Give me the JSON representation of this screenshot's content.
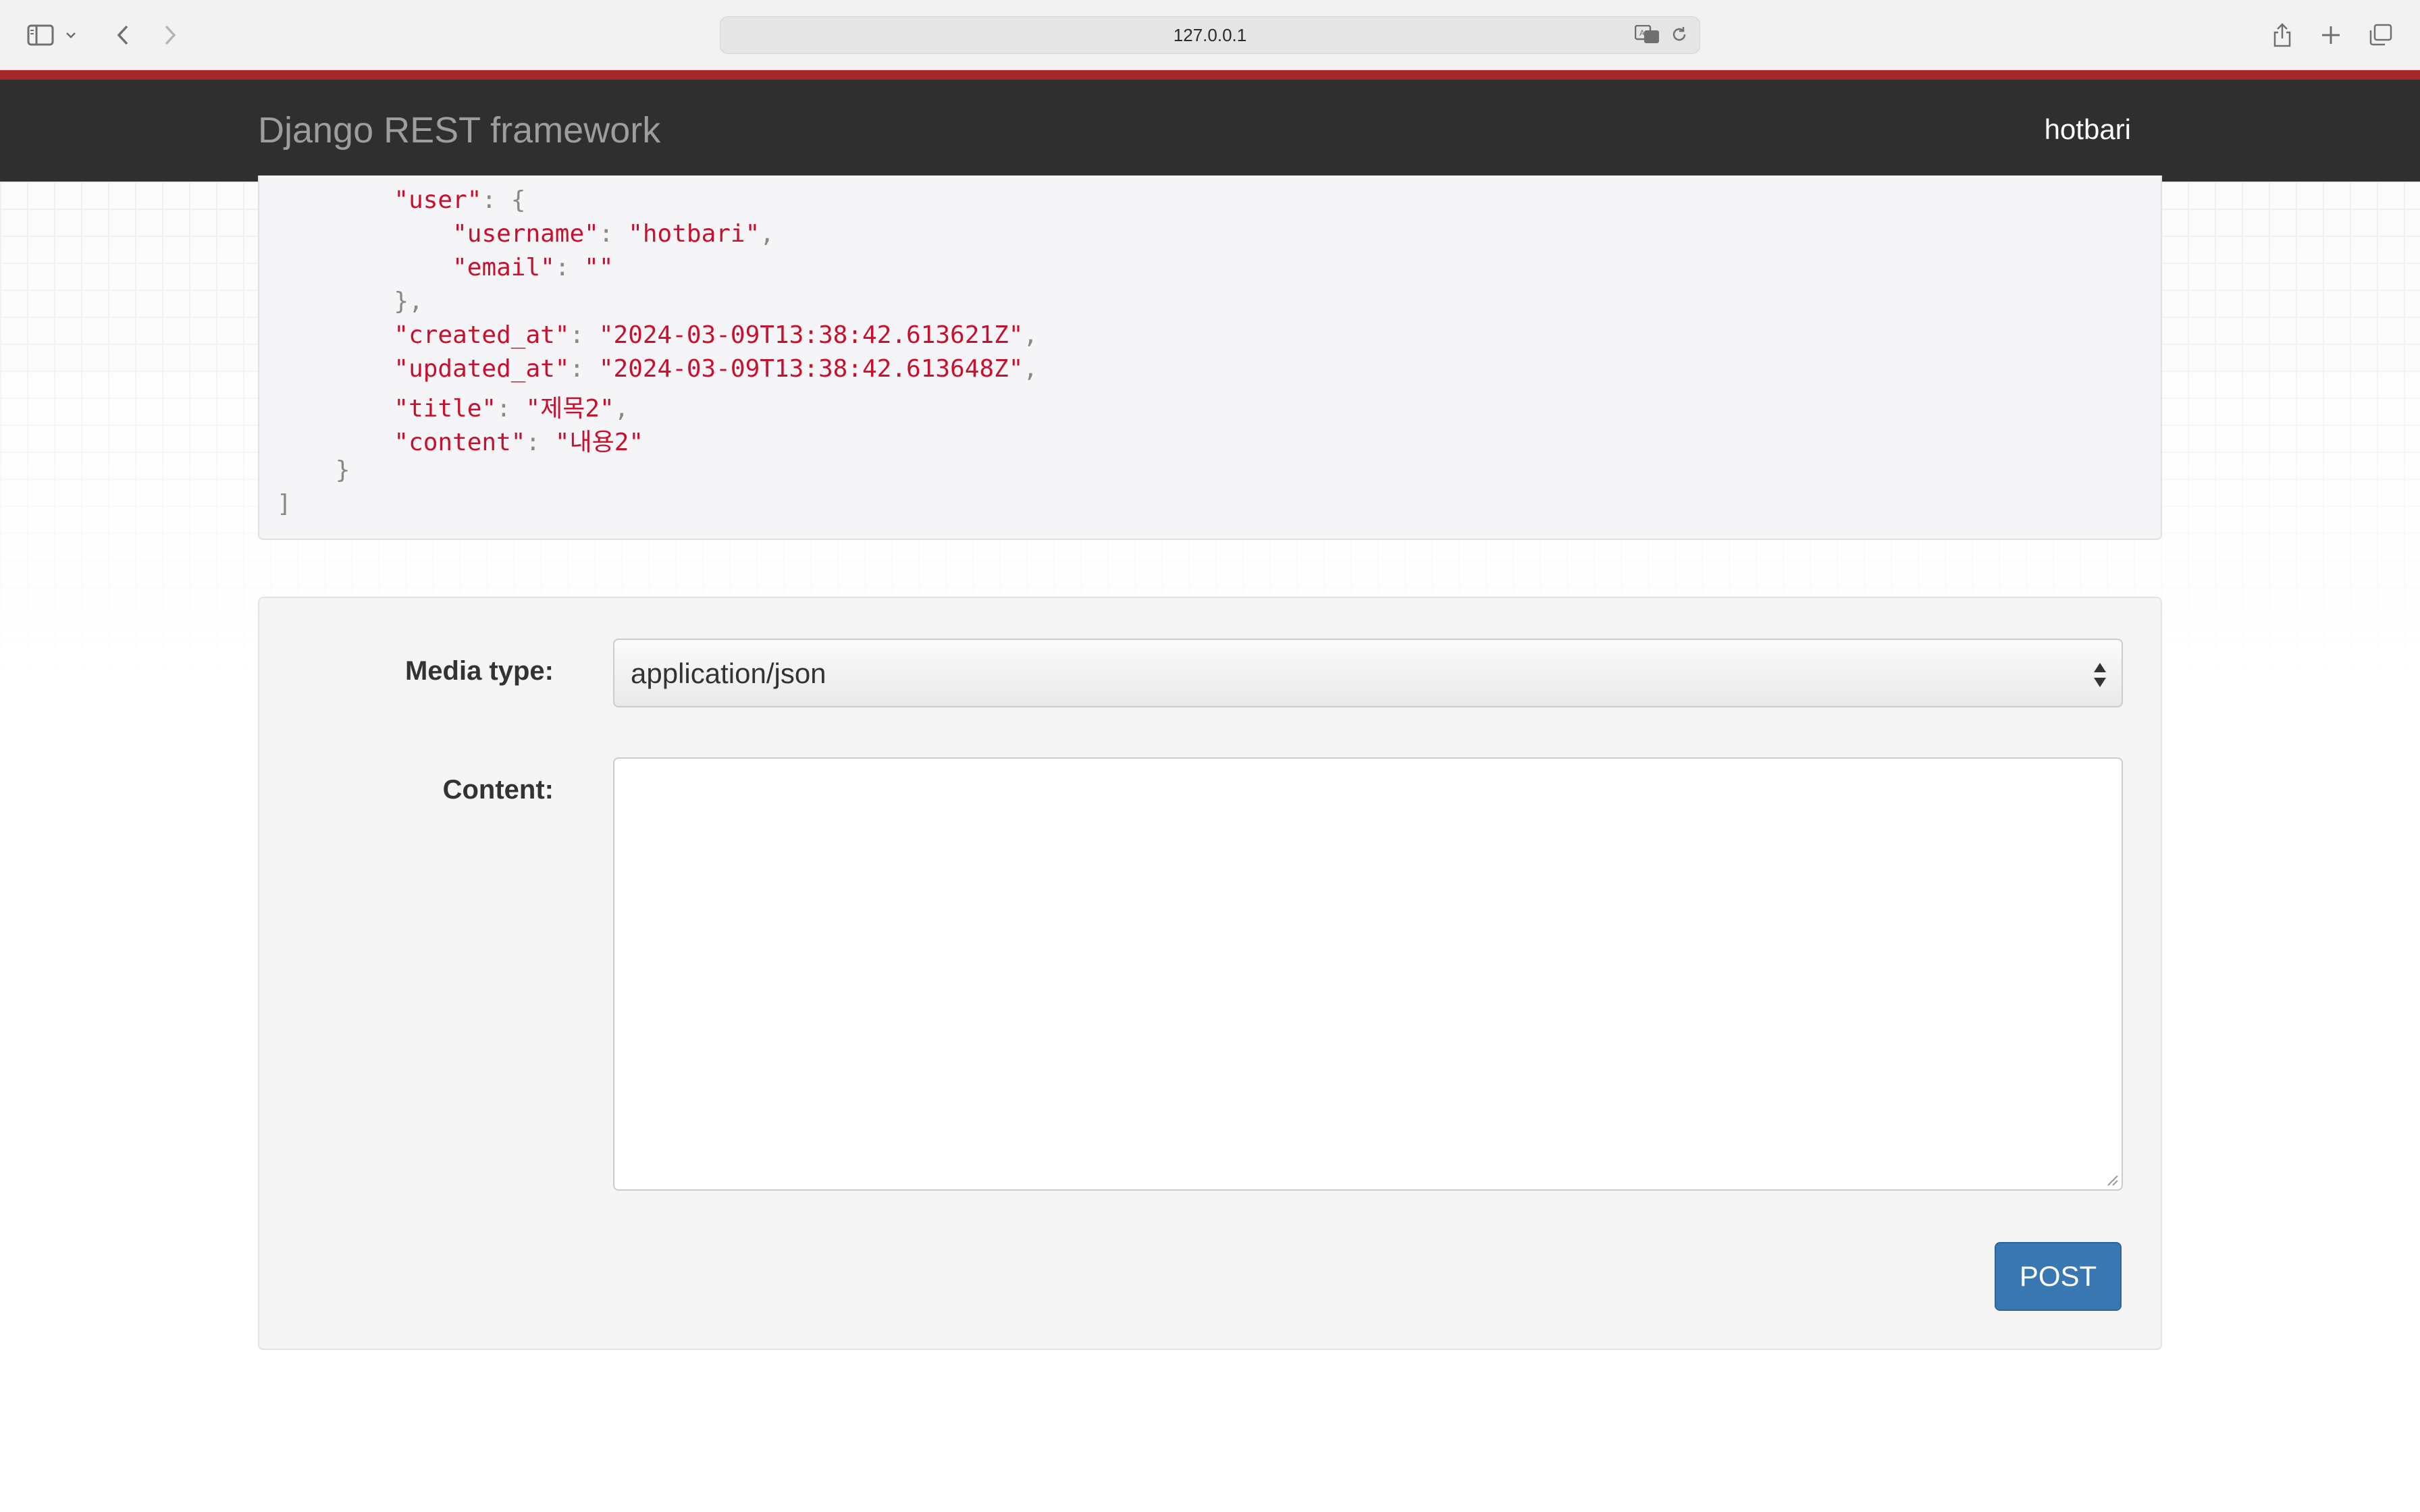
{
  "browser": {
    "url": "127.0.0.1",
    "icons": [
      "sidebar-icon",
      "chevron-down-icon",
      "back-icon",
      "forward-icon",
      "translate-icon",
      "reload-icon",
      "share-icon",
      "new-tab-icon",
      "tabs-overview-icon"
    ]
  },
  "navbar": {
    "brand": "Django REST framework",
    "user": "hotbari",
    "accent_color": "#a52828",
    "background": "#2f2f2f"
  },
  "response": {
    "lines": [
      {
        "indent": "        ",
        "key": "\"user\"",
        "sep": ": ",
        "value": "",
        "tail": "{"
      },
      {
        "indent": "            ",
        "key": "\"username\"",
        "sep": ": ",
        "value": "\"hotbari\"",
        "tail": ","
      },
      {
        "indent": "            ",
        "key": "\"email\"",
        "sep": ": ",
        "value": "\"\"",
        "tail": ""
      },
      {
        "indent": "        ",
        "key": "",
        "sep": "",
        "value": "",
        "tail": "},"
      },
      {
        "indent": "        ",
        "key": "\"created_at\"",
        "sep": ": ",
        "value": "\"2024-03-09T13:38:42.613621Z\"",
        "tail": ","
      },
      {
        "indent": "        ",
        "key": "\"updated_at\"",
        "sep": ": ",
        "value": "\"2024-03-09T13:38:42.613648Z\"",
        "tail": ","
      },
      {
        "indent": "        ",
        "key": "\"title\"",
        "sep": ": ",
        "value": "\"제목2\"",
        "tail": ","
      },
      {
        "indent": "        ",
        "key": "\"content\"",
        "sep": ": ",
        "value": "\"내용2\"",
        "tail": ""
      },
      {
        "indent": "    ",
        "key": "",
        "sep": "",
        "value": "",
        "tail": "}"
      },
      {
        "indent": "",
        "key": "",
        "sep": "",
        "value": "",
        "tail": "]"
      }
    ]
  },
  "form": {
    "media_type_label": "Media type:",
    "media_type_value": "application/json",
    "content_label": "Content:",
    "content_value": "",
    "submit_label": "POST",
    "submit_color": "#3a78b4"
  }
}
